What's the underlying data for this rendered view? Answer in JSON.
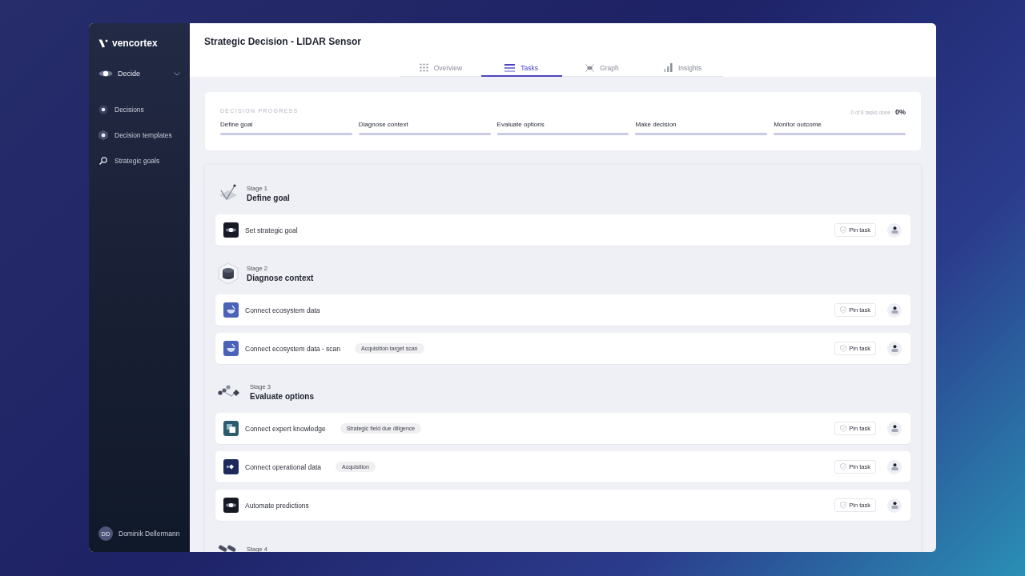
{
  "brand": "vencortex",
  "workspace": {
    "label": "Decide"
  },
  "sidebar": {
    "items": [
      {
        "label": "Decisions"
      },
      {
        "label": "Decision templates"
      },
      {
        "label": "Strategic goals"
      }
    ]
  },
  "user": {
    "initials": "DD",
    "name": "Dominik Dellermann"
  },
  "title": "Strategic Decision - LIDAR Sensor",
  "tabs": [
    {
      "label": "Overview",
      "selected": false
    },
    {
      "label": "Tasks",
      "selected": true
    },
    {
      "label": "Graph",
      "selected": false
    },
    {
      "label": "Insights",
      "selected": false
    }
  ],
  "progress": {
    "heading": "DECISION PROGRESS",
    "summary": "0 of 8 tasks done",
    "percent": "0%",
    "steps": [
      "Define goal",
      "Diagnose context",
      "Evaluate options",
      "Make decision",
      "Monitor outcome"
    ]
  },
  "stages": [
    {
      "label": "Stage 1",
      "title": "Define goal",
      "kind": "goal",
      "tasks": [
        {
          "name": "Set strategic goal",
          "kind": "spark",
          "pin": "Pin task"
        }
      ]
    },
    {
      "label": "Stage 2",
      "title": "Diagnose context",
      "kind": "stack",
      "tasks": [
        {
          "name": "Connect ecosystem data",
          "kind": "ecosystem",
          "pin": "Pin task"
        },
        {
          "name": "Connect ecosystem data - scan",
          "kind": "ecosystem",
          "tag": "Acquisition target scan",
          "pin": "Pin task"
        }
      ]
    },
    {
      "label": "Stage 3",
      "title": "Evaluate options",
      "kind": "nodes",
      "tasks": [
        {
          "name": "Connect expert knowledge",
          "kind": "expert",
          "tag": "Strategic field due diligence",
          "pin": "Pin task"
        },
        {
          "name": "Connect operational data",
          "kind": "operational",
          "tag": "Acquisition",
          "pin": "Pin task"
        },
        {
          "name": "Automate predictions",
          "kind": "spark",
          "pin": "Pin task"
        }
      ]
    },
    {
      "label": "Stage 4",
      "kind": "pills"
    }
  ]
}
